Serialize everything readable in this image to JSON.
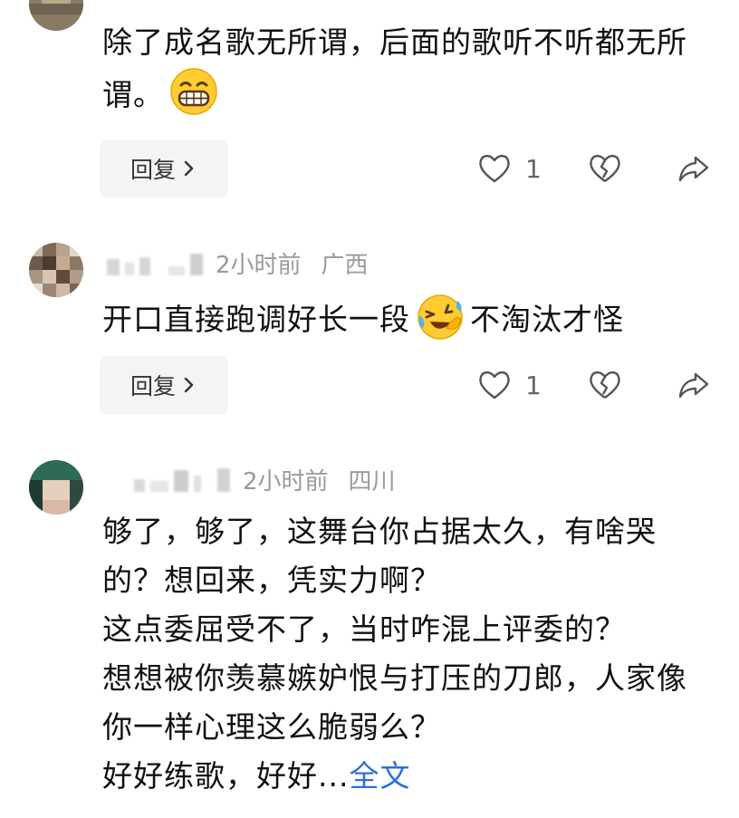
{
  "comments": [
    {
      "content_lines": [
        "除了成名歌无所谓，后面的歌听不听都无所",
        "谓。"
      ],
      "reply_label": "回复",
      "like_count": "1",
      "icons": {
        "like": "heart-icon",
        "dislike": "broken-heart-icon",
        "share": "share-icon",
        "reply_arrow": "chevron-right-icon"
      }
    },
    {
      "time": "2小时前",
      "location": "广西",
      "content_before_emoji": "开口直接跑调好长一段",
      "content_after_emoji": "不淘汰才怪",
      "emoji": "laughing-crying-emoji",
      "reply_label": "回复",
      "like_count": "1"
    },
    {
      "time": "2小时前",
      "location": "四川",
      "content_lines": [
        "够了，够了，这舞台你占据太久，有啥哭",
        "的？想回来，凭实力啊？",
        "这点委屈受不了，当时咋混上评委的？",
        "想想被你羡慕嫉妒恨与打压的刀郎，人家像",
        "你一样心理这么脆弱么？"
      ],
      "last_line": "好好练歌，好好...",
      "read_more": "全文"
    }
  ],
  "colors": {
    "link": "#2f6fd8",
    "meta": "#9a9a9a",
    "text": "#111111",
    "button_bg": "#f4f4f4"
  }
}
